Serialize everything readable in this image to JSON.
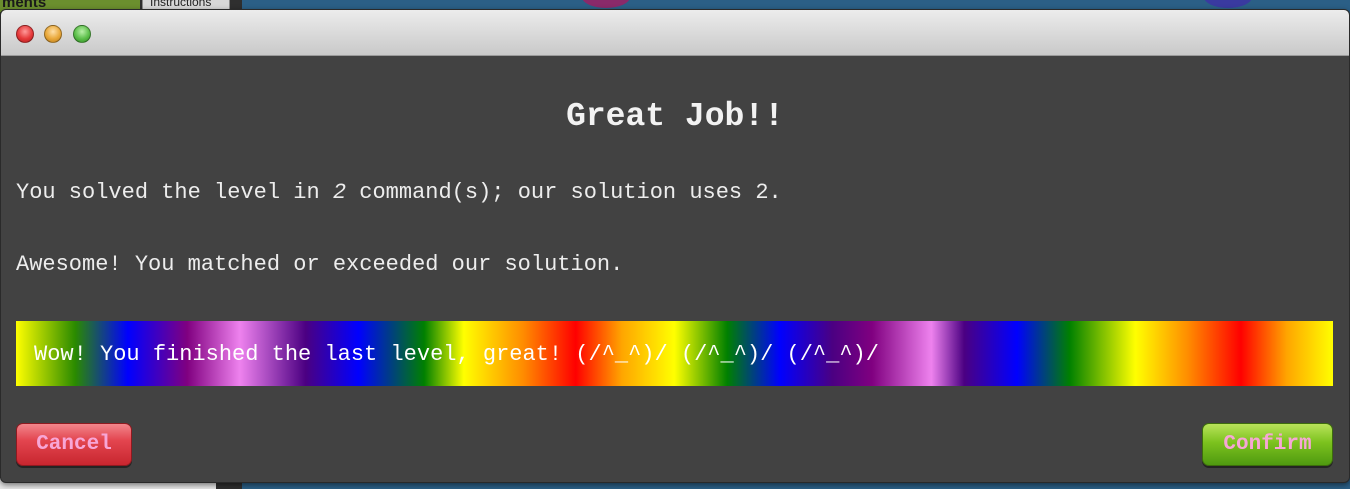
{
  "background": {
    "left_header_text": "ments",
    "instructions_tab": "Instructions"
  },
  "dialog": {
    "title": "Great Job!!",
    "line1": {
      "prefix": "You solved the level in ",
      "count": "2",
      "suffix": " command(s); our solution uses 2."
    },
    "line2": "Awesome! You matched or exceeded our solution.",
    "banner": "Wow! You finished the last level, great! (/^_^)/ (/^_^)/ (/^_^)/",
    "cancel_label": "Cancel",
    "confirm_label": "Confirm"
  },
  "colors": {
    "dialog_bg": "#424242",
    "cancel_button": "#d9333c",
    "confirm_button": "#6fb61c",
    "button_text": "#f7a6d6"
  },
  "icons": {
    "close": "window-close-icon",
    "minimize": "window-minimize-icon",
    "zoom": "window-zoom-icon"
  }
}
